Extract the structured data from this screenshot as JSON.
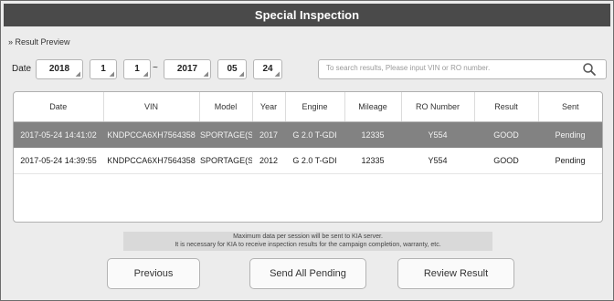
{
  "window": {
    "title": "Special Inspection"
  },
  "section": {
    "label": "» Result Preview"
  },
  "filter": {
    "label": "Date",
    "from_year": "2018",
    "from_month": "1",
    "from_day": "1",
    "separator": "~",
    "to_year": "2017",
    "to_month": "05",
    "to_day": "24",
    "search_placeholder": "To search results, Please input VIN or RO number."
  },
  "table": {
    "headers": [
      "Date",
      "VIN",
      "Model",
      "Year",
      "Engine",
      "Mileage",
      "RO Number",
      "Result",
      "Sent"
    ],
    "rows": [
      [
        "2017-05-24 14:41:02",
        "KNDPCCA6XH7564358",
        "SPORTAGE(SL)",
        "2017",
        "G 2.0 T-GDI",
        "12335",
        "Y554",
        "GOOD",
        "Pending"
      ],
      [
        "2017-05-24 14:39:55",
        "KNDPCCA6XH7564358",
        "SPORTAGE(SL)",
        "2012",
        "G 2.0 T-GDI",
        "12335",
        "Y554",
        "GOOD",
        "Pending"
      ]
    ]
  },
  "notice": {
    "line1": "Maximum data per session will be sent to KIA server.",
    "line2": "It is necessary for KIA to receive inspection results for the campaign completion, warranty, etc."
  },
  "buttons": {
    "previous": "Previous",
    "send_all": "Send All Pending",
    "review": "Review Result"
  },
  "colors": {
    "titlebar": "#4a4a4a",
    "selected_row": "#828282",
    "background": "#ececec"
  },
  "icons": {
    "search": "magnifier-icon"
  }
}
